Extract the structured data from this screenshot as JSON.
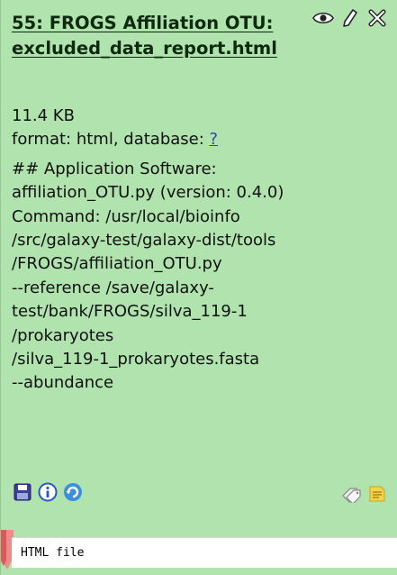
{
  "dataset": {
    "title": "55: FROGS Affiliation OTU: excluded_data_report.html",
    "size": "11.4 KB",
    "format_prefix": "format: html, database: ",
    "database": "?",
    "info": "## Application Software:\naffiliation_OTU.py (version: 0.4.0)\nCommand: /usr/local/bioinfo\n/src/galaxy-test/galaxy-dist/tools\n/FROGS/affiliation_OTU.py\n--reference /save/galaxy-\ntest/bank/FROGS/silva_119-1\n/prokaryotes\n/silva_119-1_prokaryotes.fasta\n--abundance",
    "peek": "HTML file"
  },
  "icons": {
    "header": [
      "eye-icon",
      "pencil-icon",
      "delete-icon"
    ],
    "footer_left": [
      "save-icon",
      "info-icon",
      "rerun-icon"
    ],
    "footer_right": [
      "tags-icon",
      "annotate-icon"
    ]
  },
  "colors": {
    "panel_bg": "#b0e3ae",
    "title": "#0e2a0e",
    "link": "#2a4a9a"
  }
}
